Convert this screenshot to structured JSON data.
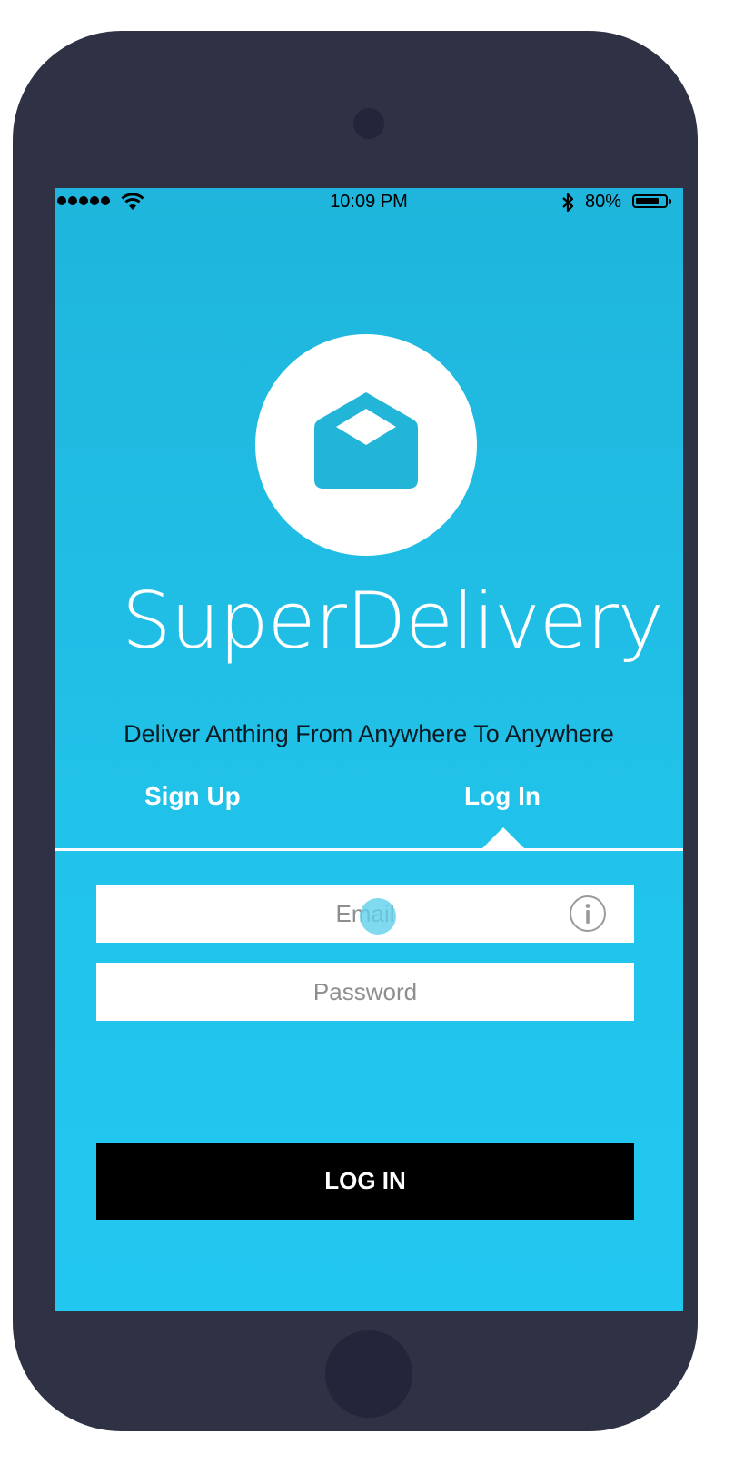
{
  "status_bar": {
    "time": "10:09 PM",
    "battery_percent": "80%",
    "battery_level": 0.8,
    "signal_dots": 5,
    "icons": [
      "signal-dots-icon",
      "wifi-icon",
      "bluetooth-icon",
      "battery-icon"
    ]
  },
  "app": {
    "name": "SuperDelivery",
    "tagline": "Deliver Anthing From Anywhere To Anywhere",
    "logo_icon": "open-envelope-icon"
  },
  "tabs": {
    "signup_label": "Sign Up",
    "login_label": "Log In",
    "active": "login"
  },
  "form": {
    "email_placeholder": "Email",
    "email_value": "",
    "password_placeholder": "Password",
    "password_value": "",
    "info_icon": "info-icon",
    "submit_label": "LOG IN"
  },
  "colors": {
    "screen_top": "#1fb5dc",
    "screen_bottom": "#22c7f0",
    "phone_body": "#2f3245",
    "button_bg": "#000000",
    "text_light": "#ffffff"
  }
}
